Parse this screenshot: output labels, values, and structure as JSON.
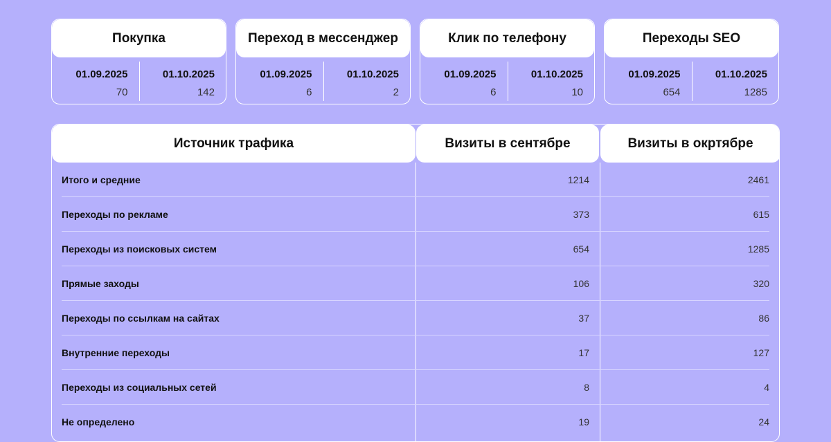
{
  "cards": [
    {
      "title": "Покупка",
      "date1": "01.09.2025",
      "val1": "70",
      "date2": "01.10.2025",
      "val2": "142"
    },
    {
      "title": "Переход в мессенджер",
      "date1": "01.09.2025",
      "val1": "6",
      "date2": "01.10.2025",
      "val2": "2"
    },
    {
      "title": "Клик по телефону",
      "date1": "01.09.2025",
      "val1": "6",
      "date2": "01.10.2025",
      "val2": "10"
    },
    {
      "title": "Переходы SEO",
      "date1": "01.09.2025",
      "val1": "654",
      "date2": "01.10.2025",
      "val2": "1285"
    }
  ],
  "table": {
    "headers": [
      "Источник трафика",
      "Визиты в сентябре",
      "Визиты в окртябре"
    ],
    "rows": [
      {
        "source": "Итого и средние",
        "sep": "1214",
        "oct": "2461"
      },
      {
        "source": "Переходы по рекламе",
        "sep": "373",
        "oct": "615"
      },
      {
        "source": "Переходы из поисковых систем",
        "sep": "654",
        "oct": "1285"
      },
      {
        "source": "Прямые заходы",
        "sep": "106",
        "oct": "320"
      },
      {
        "source": "Переходы по ссылкам на сайтах",
        "sep": "37",
        "oct": "86"
      },
      {
        "source": "Внутренние переходы",
        "sep": "17",
        "oct": "127"
      },
      {
        "source": "Переходы из социальных сетей",
        "sep": "8",
        "oct": "4"
      },
      {
        "source": "Не определено",
        "sep": "19",
        "oct": "24"
      }
    ]
  },
  "colors": {
    "background": "#b5b0fc",
    "header": "#ffffff",
    "text": "#111111"
  }
}
